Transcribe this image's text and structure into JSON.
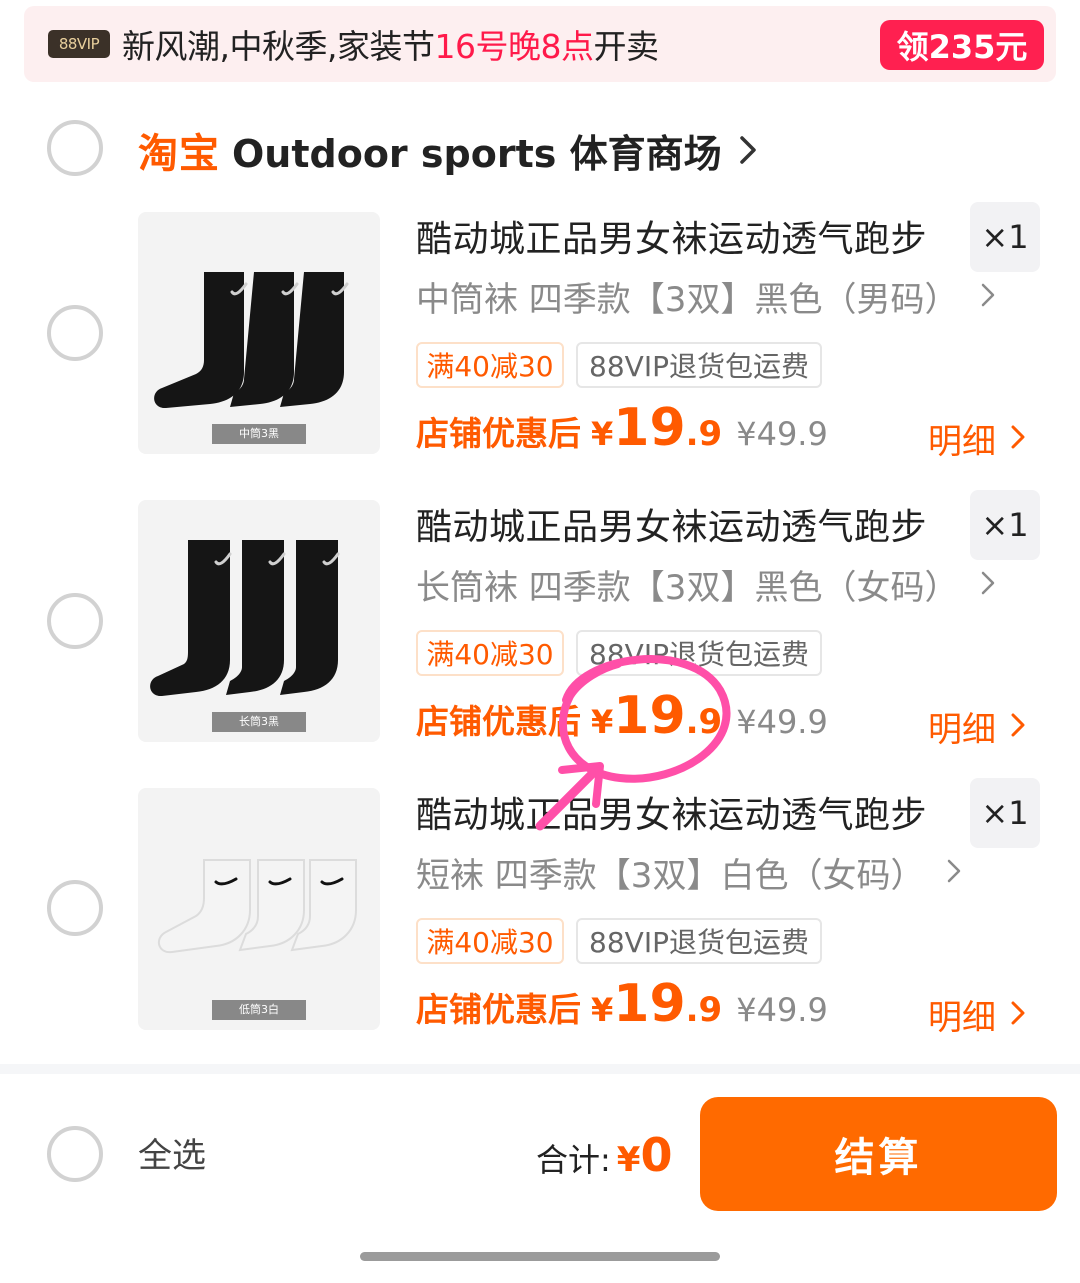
{
  "promo": {
    "badge": "88VIP",
    "text_before": "新风潮,中秋季,家装节",
    "text_highlight": "16号晚8点",
    "text_after": "开卖",
    "button": "领235元"
  },
  "shop": {
    "logo": "淘宝",
    "name": "Outdoor sports 体育商场"
  },
  "products": [
    {
      "title": "酷动城正品男女袜运动透气跑步",
      "spec": "中筒袜 四季款【3双】黑色（男码）",
      "qty": "×1",
      "tag_discount": "满40减30",
      "tag_service": "88VIP退货包运费",
      "price_label": "店铺优惠后",
      "price_yen": "¥",
      "price_int": "19",
      "price_dec": ".9",
      "price_orig": "¥49.9",
      "detail": "明细",
      "image_caption": "中筒3黑",
      "sock_color": "#151515"
    },
    {
      "title": "酷动城正品男女袜运动透气跑步",
      "spec": "长筒袜 四季款【3双】黑色（女码）",
      "qty": "×1",
      "tag_discount": "满40减30",
      "tag_service": "88VIP退货包运费",
      "price_label": "店铺优惠后",
      "price_yen": "¥",
      "price_int": "19",
      "price_dec": ".9",
      "price_orig": "¥49.9",
      "detail": "明细",
      "image_caption": "长筒3黑",
      "sock_color": "#151515"
    },
    {
      "title": "酷动城正品男女袜运动透气跑步",
      "spec": "短袜 四季款【3双】白色（女码）",
      "qty": "×1",
      "tag_discount": "满40减30",
      "tag_service": "88VIP退货包运费",
      "price_label": "店铺优惠后",
      "price_yen": "¥",
      "price_int": "19",
      "price_dec": ".9",
      "price_orig": "¥49.9",
      "detail": "明细",
      "image_caption": "低筒3白",
      "sock_color": "#f4f4f4"
    }
  ],
  "bottom": {
    "select_all": "全选",
    "total_label": "合计:",
    "total_yen": "¥",
    "total_value": "0",
    "checkout": "结算"
  },
  "colors": {
    "accent": "#ff5a00",
    "promo_red": "#ff2050",
    "annotation_pink": "#ff4fa8"
  },
  "icons": [
    "radio-unchecked-icon",
    "chevron-right-icon",
    "taobao-logo"
  ]
}
